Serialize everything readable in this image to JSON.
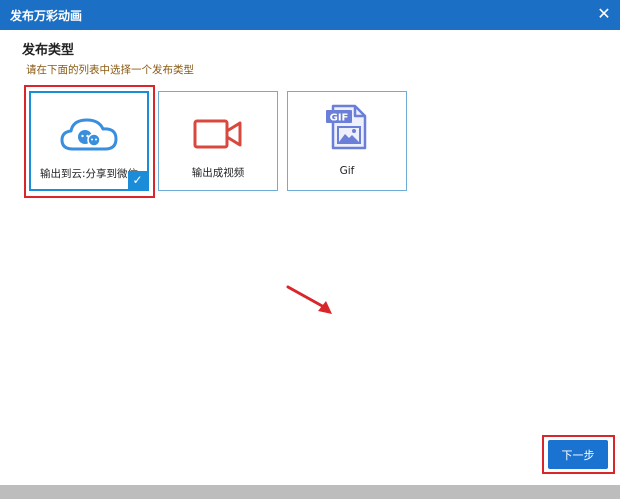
{
  "window": {
    "title": "发布万彩动画",
    "close_glyph": "✕"
  },
  "section": {
    "heading": "发布类型",
    "instruction": "请在下面的列表中选择一个发布类型"
  },
  "publish_types": [
    {
      "label": "输出到云:分享到微信",
      "icon": "cloud-share-icon",
      "selected": true,
      "color": "#3a8ede"
    },
    {
      "label": "输出成视频",
      "icon": "video-camera-icon",
      "selected": false,
      "color": "#d8483c"
    },
    {
      "label": "Gif",
      "icon": "gif-file-icon",
      "selected": false,
      "color": "#6b7fd8",
      "icon_text": "GIF"
    }
  ],
  "footer": {
    "next_label": "下一步"
  },
  "colors": {
    "titlebar": "#1b6fc4",
    "accent": "#1a8cd8",
    "highlight": "#d9262a",
    "instruction": "#8a5a12"
  }
}
